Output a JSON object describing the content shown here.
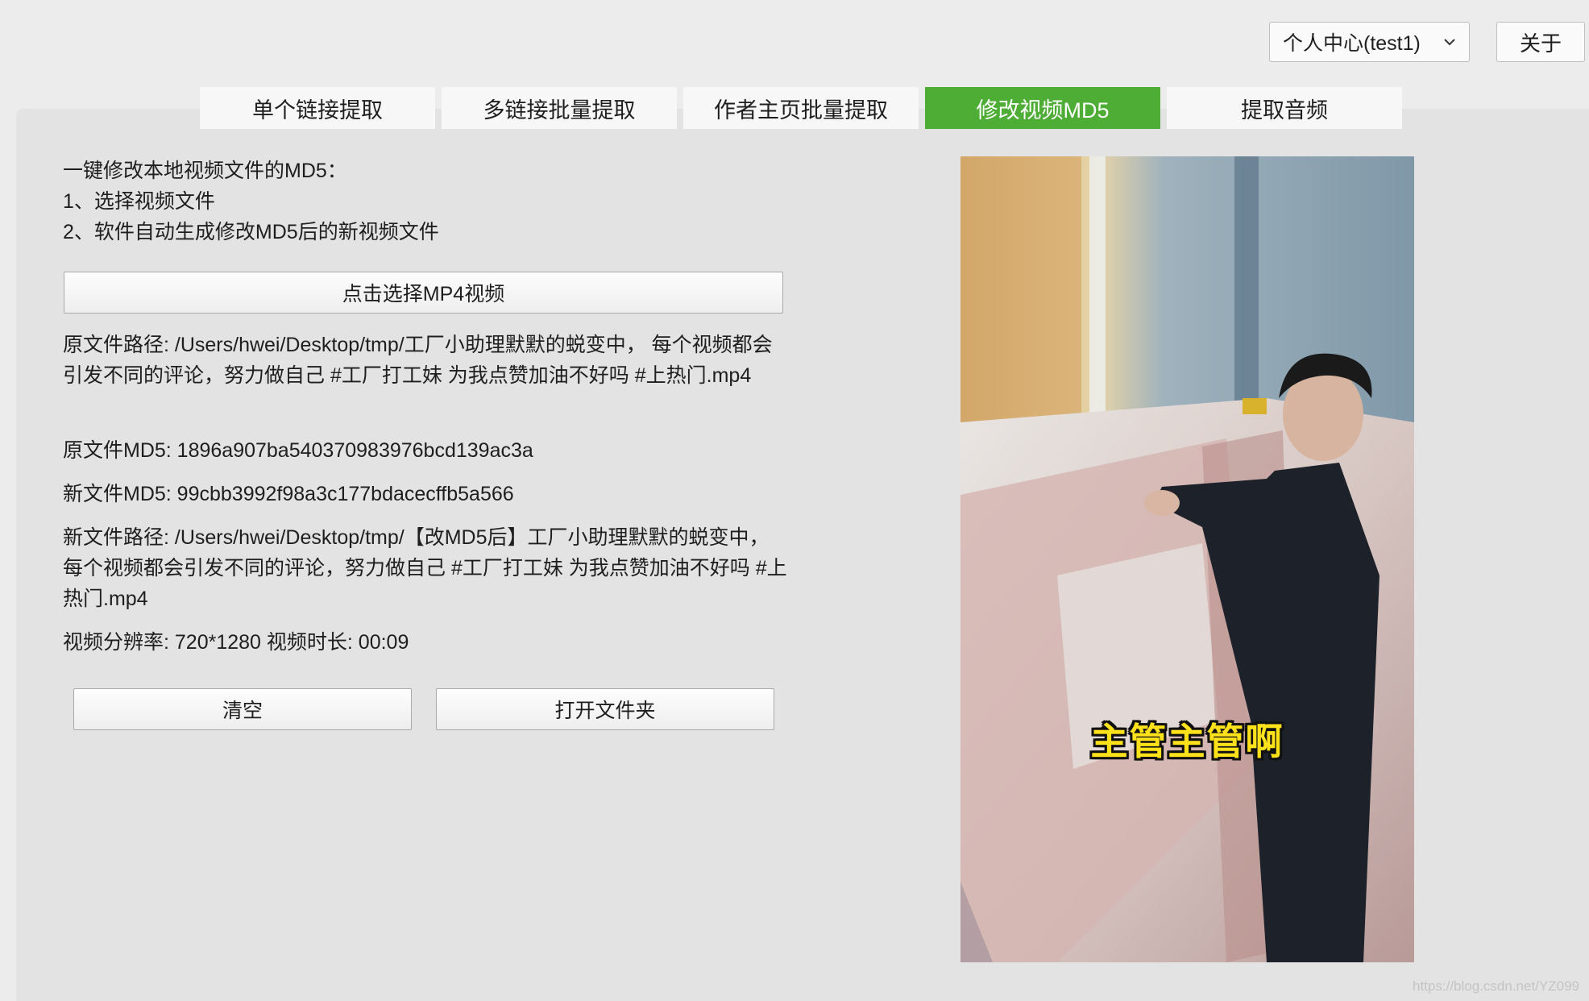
{
  "header": {
    "user_select": {
      "value": "个人中心(test1)"
    },
    "about_label": "关于"
  },
  "tabs": [
    {
      "label": "单个链接提取",
      "active": false
    },
    {
      "label": "多链接批量提取",
      "active": false
    },
    {
      "label": "作者主页批量提取",
      "active": false
    },
    {
      "label": "修改视频MD5",
      "active": true
    },
    {
      "label": "提取音频",
      "active": false
    }
  ],
  "intro": {
    "line1": "一键修改本地视频文件的MD5：",
    "line2": "1、选择视频文件",
    "line3": "2、软件自动生成修改MD5后的新视频文件"
  },
  "choose_button": "点击选择MP4视频",
  "info": {
    "src_path": "原文件路径: /Users/hwei/Desktop/tmp/工厂小助理默默的蜕变中， 每个视频都会引发不同的评论，努力做自己 #工厂打工妹 为我点赞加油不好吗 #上热门.mp4",
    "src_md5": "原文件MD5: 1896a907ba540370983976bcd139ac3a",
    "new_md5": "新文件MD5: 99cbb3992f98a3c177bdacecffb5a566",
    "new_path": "新文件路径: /Users/hwei/Desktop/tmp/【改MD5后】工厂小助理默默的蜕变中， 每个视频都会引发不同的评论，努力做自己 #工厂打工妹 为我点赞加油不好吗 #上热门.mp4",
    "video_meta": "视频分辨率: 720*1280   视频时长: 00:09"
  },
  "buttons": {
    "clear": "清空",
    "open_folder": "打开文件夹"
  },
  "video": {
    "subtitle": "主管主管啊"
  },
  "watermark": "https://blog.csdn.net/YZ099",
  "colors": {
    "accent": "#4ead35",
    "subtitle": "#ffe21a"
  }
}
